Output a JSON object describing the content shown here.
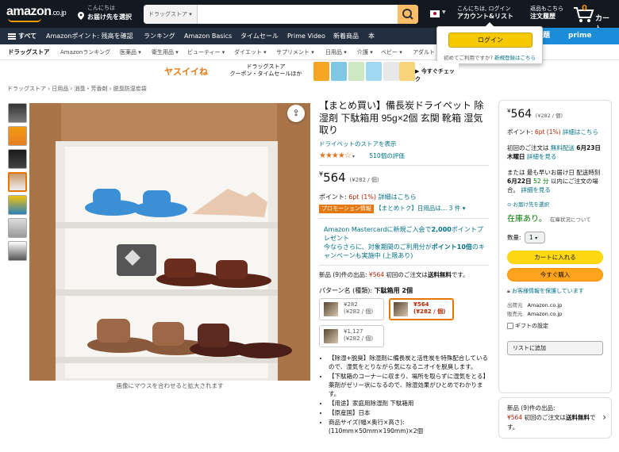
{
  "header": {
    "logo": "amazon",
    "logo_suffix": ".co.jp",
    "deliver_line1": "こんにちは",
    "deliver_line2": "お届け先を選択",
    "search_category": "ドラッグストア",
    "search_value": "",
    "search_placeholder": "",
    "flag_icon": "japan-flag-icon",
    "account_line1": "こんにちは, ログイン",
    "account_line2": "アカウント&リスト",
    "orders_line1": "返品もこちら",
    "orders_line2": "注文履歴",
    "cart_count": "0",
    "cart_label": "カート"
  },
  "nav": {
    "all": "すべて",
    "items": [
      "Amazonポイント: 残高を確認",
      "ランキング",
      "Amazon Basics",
      "タイムセール",
      "Prime Video",
      "新着商品",
      "本"
    ],
    "banner_kanji": "題",
    "banner": "prime reading"
  },
  "subnav": {
    "first": "ドラッグストア",
    "items": [
      "Amazonランキング",
      "医薬品 ▾",
      "衛生用品 ▾",
      "ビューティー ▾",
      "ダイエット ▾",
      "サプリメント ▾",
      "日用品 ▾",
      "介護 ▾",
      "ベビー ▾",
      "アダルト"
    ]
  },
  "login_popover": {
    "button": "ログイン",
    "new_text": "初めてご利用ですか?",
    "new_link": "新規登録はこちら"
  },
  "promo": {
    "logo": "ヤスイイね",
    "text_line1": "ドラッグストア",
    "text_line2": "クーポン・タイムセールほか",
    "cta": "▶ 今すぐチェック"
  },
  "breadcrumb": "ドラッグストア › 日用品 › 消臭・芳香剤 › 脱臭防湿炭袋",
  "image": {
    "zoom_hint": "画像にマウスを合わせると拡大されます"
  },
  "product": {
    "title": "【まとめ買い】備長炭ドライペット 除湿剤 下駄箱用 95g×2個 玄関 靴箱 湿気取り",
    "store": "ドライペットのストアを表示",
    "stars": "★★★★☆",
    "rating_count": "510個の評価",
    "price_yen": "¥",
    "price": "564",
    "unit_price": "(¥282 / 個)",
    "points_label": "ポイント: ",
    "points_value": "6pt (1%)",
    "points_link": "詳細はこちら",
    "promo_badge": "プロモーション情報",
    "promo_text": "【まとめトク】日用品は… 3 件 ▾",
    "card_offer_1": "Amazon Mastercardに新規ご入会で",
    "card_offer_bold": "2,000",
    "card_offer_2": "ポイントプレゼント",
    "card_offer_3": "今ならさらに、対象期間のご利用分が",
    "card_offer_bold2": "ポイント10倍",
    "card_offer_4": "のキャンペーンも実施中 (上限あり)",
    "new_offer_1": "新品 (9)件の出品: ",
    "new_offer_price": "¥564",
    "new_offer_2": " 初回のご注文は",
    "new_offer_bold": "送料無料",
    "new_offer_3": "です。",
    "pattern_label": "パターン名 (種類): ",
    "pattern_value": "下駄箱用 2個",
    "swatches": [
      {
        "price": "¥282",
        "unit": "(¥282 / 個)",
        "selected": false
      },
      {
        "price": "¥564",
        "unit": "(¥282 / 個)",
        "selected": true
      },
      {
        "price": "¥1,127",
        "unit": "(¥282 / 個)",
        "selected": false
      }
    ],
    "bullets": [
      "【除湿+脱臭】除湿剤に備長炭と活性炭を特殊配合しているので、湿気をとりながら気になるニオイを脱臭します。",
      "【下駄箱のコーナーに収まり、場所を取らずに湿気をとる】薬剤がゼリー状になるので、除湿効果がひとめでわかります。",
      "【用途】家庭用除湿剤 下駄箱用",
      "【原産国】日本",
      "商品サイズ(幅×奥行×高さ): (110mm×50mm×190mm)×2個"
    ]
  },
  "buybox": {
    "price_yen": "¥",
    "price": "564",
    "unit": "(¥282 / 個)",
    "points_label": "ポイント: ",
    "points_value": "6pt (1%)",
    "points_link": "詳細はこちら",
    "ship_1": "初回のご注文は ",
    "ship_link": "無料配送",
    "ship_bold": "6月23日 木曜日",
    "ship_detail": "詳細を見る",
    "fast_1": "または 最も早いお届け日 配送時刻 ",
    "fast_bold": "6月22日",
    "fast_green": "52 分",
    "fast_2": "以内にご注文の場合。",
    "fast_link": "詳細を見る",
    "location": "お届け先を選択",
    "stock": "在庫あり。",
    "stock_more": "在庫状況について",
    "qty_label": "数量:",
    "qty_value": "1",
    "add_cart": "カートに入れる",
    "buy_now": "今すぐ購入",
    "secure": "お客様情報を保護しています",
    "shipper_label": "出荷元",
    "shipper": "Amazon.co.jp",
    "seller_label": "販売元",
    "seller": "Amazon.co.jp",
    "gift": "ギフトの設定",
    "wishlist": "リストに追加"
  },
  "other_sellers": {
    "line1": "新品 (9)件の出品:",
    "price": "¥564",
    "line2": " 初回のご注文は",
    "bold": "送料無料",
    "line3": "です。"
  },
  "colors": {
    "header_bg": "#131921",
    "nav_bg": "#232f3e",
    "accent": "#ff9900",
    "add_cart": "#ffd814",
    "buy_now": "#ffa41c",
    "link": "#007185",
    "price_red": "#b12704"
  }
}
